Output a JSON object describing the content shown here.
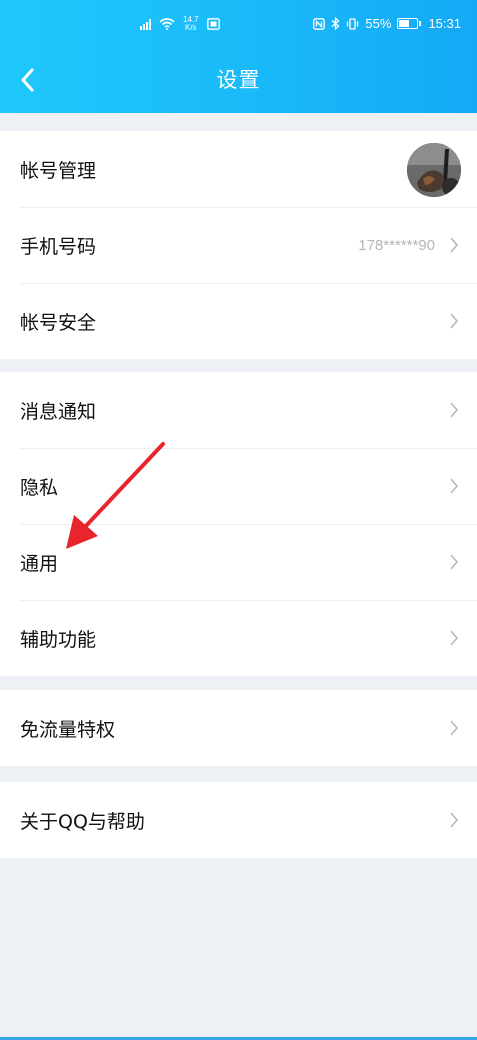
{
  "status_bar": {
    "net_speed_value": "14.7",
    "net_speed_unit": "K/s",
    "battery": "55%",
    "battery_level": 0.55,
    "time": "15:31"
  },
  "header": {
    "title": "设置"
  },
  "groups": [
    {
      "items": [
        {
          "label": "帐号管理",
          "value": ""
        },
        {
          "label": "手机号码",
          "value": "178******90"
        },
        {
          "label": "帐号安全",
          "value": ""
        }
      ]
    },
    {
      "items": [
        {
          "label": "消息通知"
        },
        {
          "label": "隐私"
        },
        {
          "label": "通用"
        },
        {
          "label": "辅助功能"
        }
      ]
    },
    {
      "items": [
        {
          "label": "免流量特权"
        }
      ]
    },
    {
      "items": [
        {
          "label": "关于QQ与帮助"
        }
      ]
    }
  ],
  "colors": {
    "header_gradient_start": "#1fc8fb",
    "header_gradient_end": "#14a9f6",
    "page_background": "#edf0f5",
    "annotation_arrow": "#e8242c"
  }
}
